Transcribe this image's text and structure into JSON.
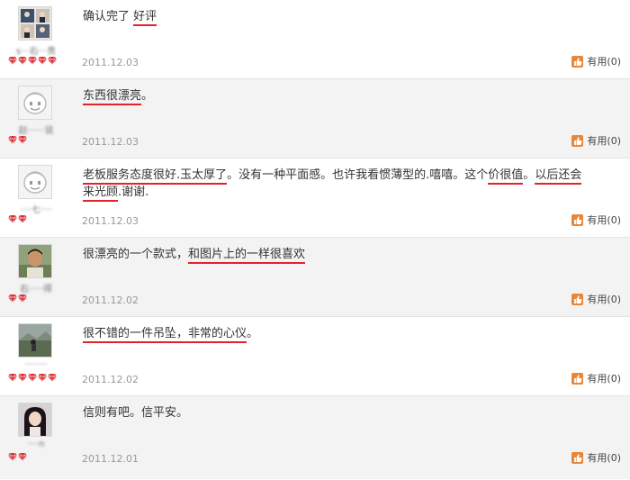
{
  "reviews": [
    {
      "avatar": "photo-avatar-group",
      "username": "s···右···贵",
      "rank_gems": 5,
      "parts": [
        {
          "text": "确认完了 ",
          "underline": false
        },
        {
          "text": "好评",
          "underline": true
        }
      ],
      "date": "2011.12.03",
      "useful_label": "有用(0)"
    },
    {
      "avatar": "default-smiley-avatar",
      "username": "赵······说",
      "rank_gems": 2,
      "parts": [
        {
          "text": "东西很漂亮",
          "underline": true
        },
        {
          "text": "。",
          "underline": false
        }
      ],
      "date": "2011.12.03",
      "useful_label": "有用(0)"
    },
    {
      "avatar": "default-smiley-avatar",
      "username": "····七····",
      "rank_gems": 2,
      "parts": [
        {
          "text": "老板服务态度很好.玉太厚了",
          "underline": true
        },
        {
          "text": "。没有一种平面感。也许我看惯薄型的.嘻嘻。这个",
          "underline": false
        },
        {
          "text": "价很值",
          "underline": true
        },
        {
          "text": "。",
          "underline": false
        },
        {
          "text": "以后还会来光顾",
          "underline": true
        },
        {
          "text": ".谢谢.",
          "underline": false
        }
      ],
      "date": "2011.12.03",
      "useful_label": "有用(0)"
    },
    {
      "avatar": "photo-avatar-man",
      "username": "右·····得",
      "rank_gems": 2,
      "parts": [
        {
          "text": "很漂亮的一个款式，",
          "underline": false
        },
        {
          "text": "和图片上的一样很喜欢",
          "underline": true
        }
      ],
      "date": "2011.12.02",
      "useful_label": "有用(0)"
    },
    {
      "avatar": "photo-avatar-outdoor",
      "username": "········",
      "rank_gems": 5,
      "parts": [
        {
          "text": "很不错的一件吊坠，非常的心仪",
          "underline": true
        },
        {
          "text": "。",
          "underline": false
        }
      ],
      "date": "2011.12.02",
      "useful_label": "有用(0)"
    },
    {
      "avatar": "photo-avatar-woman",
      "username": "····n",
      "rank_gems": 2,
      "parts": [
        {
          "text": "信则有吧。信平安。",
          "underline": false
        }
      ],
      "date": "2011.12.01",
      "useful_label": "有用(0)"
    }
  ],
  "colors": {
    "underline": "#e0242c",
    "gem": "#d9282f",
    "useful_icon": "#e8873a",
    "row_alt_bg": "#f3f3f3"
  }
}
